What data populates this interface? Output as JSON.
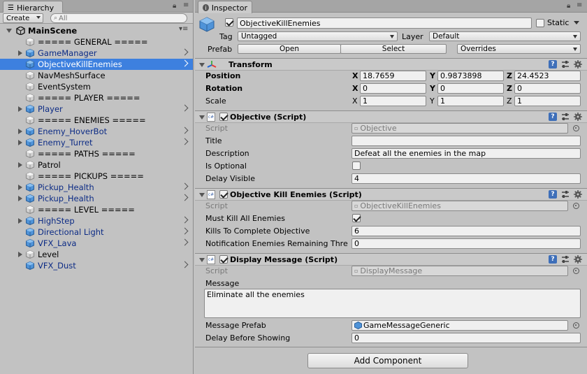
{
  "hierarchy": {
    "tab_label": "Hierarchy",
    "create_label": "Create",
    "search_placeholder": "All",
    "scene_name": "MainScene",
    "items": [
      {
        "label": "===== GENERAL =====",
        "prefab": false,
        "expandable": false,
        "arrow": false,
        "selected": false
      },
      {
        "label": "GameManager",
        "prefab": true,
        "expandable": true,
        "arrow": true,
        "selected": false
      },
      {
        "label": "ObjectiveKillEnemies",
        "prefab": true,
        "expandable": false,
        "arrow": true,
        "selected": true
      },
      {
        "label": "NavMeshSurface",
        "prefab": false,
        "expandable": false,
        "arrow": false,
        "selected": false
      },
      {
        "label": "EventSystem",
        "prefab": false,
        "expandable": false,
        "arrow": false,
        "selected": false
      },
      {
        "label": "===== PLAYER =====",
        "prefab": false,
        "expandable": false,
        "arrow": false,
        "selected": false
      },
      {
        "label": "Player",
        "prefab": true,
        "expandable": true,
        "arrow": true,
        "selected": false
      },
      {
        "label": "===== ENEMIES =====",
        "prefab": false,
        "expandable": false,
        "arrow": false,
        "selected": false
      },
      {
        "label": "Enemy_HoverBot",
        "prefab": true,
        "expandable": true,
        "arrow": true,
        "selected": false
      },
      {
        "label": "Enemy_Turret",
        "prefab": true,
        "expandable": true,
        "arrow": true,
        "selected": false
      },
      {
        "label": "===== PATHS =====",
        "prefab": false,
        "expandable": false,
        "arrow": false,
        "selected": false
      },
      {
        "label": "Patrol",
        "prefab": false,
        "expandable": true,
        "arrow": false,
        "selected": false
      },
      {
        "label": "===== PICKUPS =====",
        "prefab": false,
        "expandable": false,
        "arrow": false,
        "selected": false
      },
      {
        "label": "Pickup_Health",
        "prefab": true,
        "expandable": true,
        "arrow": true,
        "selected": false
      },
      {
        "label": "Pickup_Health",
        "prefab": true,
        "expandable": true,
        "arrow": true,
        "selected": false
      },
      {
        "label": "===== LEVEL =====",
        "prefab": false,
        "expandable": false,
        "arrow": false,
        "selected": false
      },
      {
        "label": "HighStep",
        "prefab": true,
        "expandable": true,
        "arrow": true,
        "selected": false
      },
      {
        "label": "Directional Light",
        "prefab": true,
        "expandable": false,
        "arrow": true,
        "selected": false
      },
      {
        "label": "VFX_Lava",
        "prefab": true,
        "expandable": false,
        "arrow": true,
        "selected": false
      },
      {
        "label": "Level",
        "prefab": false,
        "expandable": true,
        "arrow": false,
        "selected": false
      },
      {
        "label": "VFX_Dust",
        "prefab": true,
        "expandable": false,
        "arrow": true,
        "selected": false
      }
    ]
  },
  "inspector": {
    "tab_label": "Inspector",
    "object_name": "ObjectiveKillEnemies",
    "static_label": "Static",
    "tag_label": "Tag",
    "tag_value": "Untagged",
    "layer_label": "Layer",
    "layer_value": "Default",
    "prefab_label": "Prefab",
    "open_label": "Open",
    "select_label": "Select",
    "overrides_label": "Overrides",
    "transform": {
      "title": "Transform",
      "position_label": "Position",
      "rotation_label": "Rotation",
      "scale_label": "Scale",
      "position": {
        "x": "18.7659",
        "y": "0.9873898",
        "z": "24.4523"
      },
      "rotation": {
        "x": "0",
        "y": "0",
        "z": "0"
      },
      "scale": {
        "x": "1",
        "y": "1",
        "z": "1"
      }
    },
    "objective": {
      "title": "Objective (Script)",
      "script_label": "Script",
      "script_value": "Objective",
      "title_label": "Title",
      "title_value": "",
      "description_label": "Description",
      "description_value": "Defeat all the enemies in the map",
      "optional_label": "Is Optional",
      "delay_label": "Delay Visible",
      "delay_value": "4"
    },
    "kill_enemies": {
      "title": "Objective Kill Enemies (Script)",
      "script_label": "Script",
      "script_value": "ObjectiveKillEnemies",
      "must_kill_label": "Must Kill All Enemies",
      "kills_label": "Kills To Complete Objective",
      "kills_value": "6",
      "notification_label": "Notification Enemies Remaining Thre",
      "notification_value": "0"
    },
    "display_message": {
      "title": "Display Message (Script)",
      "script_label": "Script",
      "script_value": "DisplayMessage",
      "message_label": "Message",
      "message_value": "Eliminate all the enemies",
      "prefab_label": "Message Prefab",
      "prefab_value": "GameMessageGeneric",
      "delay_label": "Delay Before Showing",
      "delay_value": "0"
    },
    "add_component_label": "Add Component"
  },
  "colors": {
    "selection": "#3d80df",
    "prefab_text": "#0c2b85",
    "panel_bg": "#c2c2c2"
  }
}
